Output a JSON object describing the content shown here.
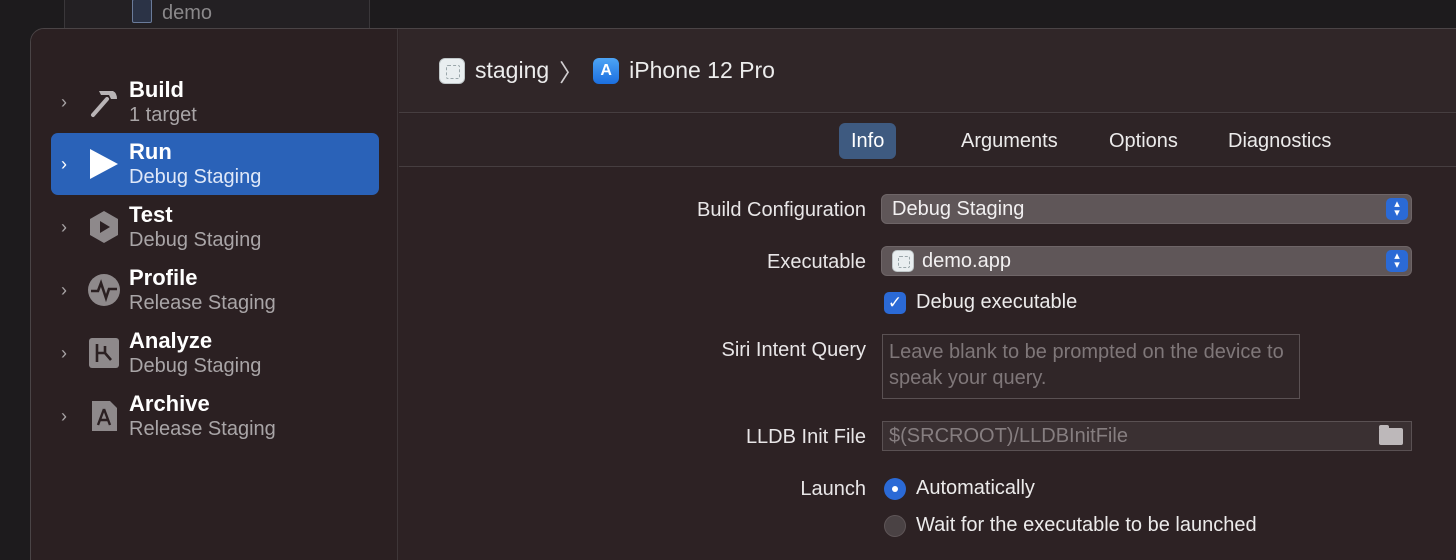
{
  "background_window": {
    "file_label": "demo"
  },
  "sidebar": {
    "items": [
      {
        "name": "Build",
        "sub": "1 target",
        "icon": "hammer-icon",
        "selected": false
      },
      {
        "name": "Run",
        "sub": "Debug Staging",
        "icon": "play-icon",
        "selected": true
      },
      {
        "name": "Test",
        "sub": "Debug Staging",
        "icon": "test-icon",
        "selected": false
      },
      {
        "name": "Profile",
        "sub": "Release Staging",
        "icon": "profile-icon",
        "selected": false
      },
      {
        "name": "Analyze",
        "sub": "Debug Staging",
        "icon": "analyze-icon",
        "selected": false
      },
      {
        "name": "Archive",
        "sub": "Release Staging",
        "icon": "archive-icon",
        "selected": false
      }
    ]
  },
  "breadcrumb": {
    "scheme": "staging",
    "separator": "〉",
    "destination": "iPhone 12 Pro"
  },
  "tabs": [
    {
      "label": "Info",
      "active": true
    },
    {
      "label": "Arguments",
      "active": false
    },
    {
      "label": "Options",
      "active": false
    },
    {
      "label": "Diagnostics",
      "active": false
    }
  ],
  "form": {
    "build_configuration_label": "Build Configuration",
    "build_configuration_value": "Debug Staging",
    "executable_label": "Executable",
    "executable_value": "demo.app",
    "debug_executable_label": "Debug executable",
    "debug_executable_checked": true,
    "siri_intent_label": "Siri Intent Query",
    "siri_intent_placeholder": "Leave blank to be prompted on the device to speak your query.",
    "lldb_init_label": "LLDB Init File",
    "lldb_init_placeholder": "$(SRCROOT)/LLDBInitFile",
    "launch_label": "Launch",
    "launch_options": [
      {
        "label": "Automatically",
        "selected": true
      },
      {
        "label": "Wait for the executable to be launched",
        "selected": false
      }
    ]
  },
  "colors": {
    "accent": "#2b6ad6",
    "selection": "#2a62b8",
    "panel": "#2d2224"
  }
}
